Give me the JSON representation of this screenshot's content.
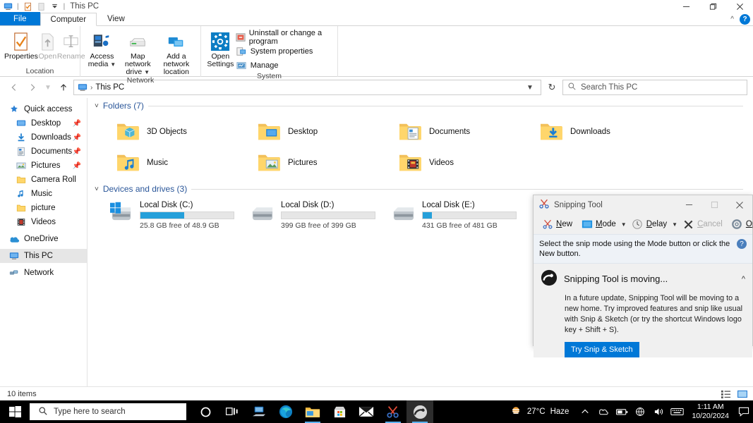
{
  "window": {
    "title": "This PC",
    "quick_access_icons": [
      "this-pc-icon",
      "properties-icon",
      "new-folder-icon",
      "customize-icon"
    ],
    "controls": {
      "minimize": "minimize-icon",
      "restore": "restore-icon",
      "close": "close-icon"
    },
    "ribbon_collapse": "chevron-up-icon",
    "help": "?"
  },
  "tabs": [
    {
      "label": "File",
      "state": "file-menu"
    },
    {
      "label": "Computer",
      "state": "active"
    },
    {
      "label": "View",
      "state": "normal"
    }
  ],
  "ribbon": {
    "groups": [
      {
        "label": "Location",
        "big_buttons": [
          {
            "label": "Properties",
            "icon": "properties-icon",
            "enabled": true
          },
          {
            "label": "Open",
            "icon": "open-icon",
            "enabled": false
          },
          {
            "label": "Rename",
            "icon": "rename-icon",
            "enabled": false
          }
        ]
      },
      {
        "label": "Network",
        "big_buttons": [
          {
            "label": "Access media",
            "icon": "access-media-icon",
            "enabled": true,
            "dropdown": true
          },
          {
            "label": "Map network drive",
            "icon": "map-network-drive-icon",
            "enabled": true,
            "dropdown": true
          },
          {
            "label": "Add a network location",
            "icon": "add-network-location-icon",
            "enabled": true,
            "dropdown": false
          }
        ]
      },
      {
        "label": "System",
        "big_buttons": [
          {
            "label": "Open Settings",
            "icon": "settings-gear-icon",
            "enabled": true
          }
        ],
        "small_buttons": [
          {
            "label": "Uninstall or change a program",
            "icon": "uninstall-icon"
          },
          {
            "label": "System properties",
            "icon": "system-properties-icon"
          },
          {
            "label": "Manage",
            "icon": "manage-icon"
          }
        ]
      }
    ]
  },
  "addressbar": {
    "back": "back-arrow-icon",
    "forward": "forward-arrow-icon",
    "recent": "chevron-down-icon",
    "up": "up-arrow-icon",
    "crumb_icon": "this-pc-icon",
    "crumb": "This PC",
    "separator": "›",
    "dropdown": "chevron-down-icon",
    "refresh": "↻"
  },
  "search": {
    "placeholder": "Search This PC",
    "icon": "search-icon"
  },
  "sidebar": {
    "items": [
      {
        "label": "Quick access",
        "icon": "star-pin-icon",
        "indent": false,
        "pinned": false,
        "selected": false
      },
      {
        "label": "Desktop",
        "icon": "desktop-icon",
        "indent": true,
        "pinned": true,
        "selected": false
      },
      {
        "label": "Downloads",
        "icon": "downloads-icon",
        "indent": true,
        "pinned": true,
        "selected": false
      },
      {
        "label": "Documents",
        "icon": "documents-icon",
        "indent": true,
        "pinned": true,
        "selected": false
      },
      {
        "label": "Pictures",
        "icon": "pictures-icon",
        "indent": true,
        "pinned": true,
        "selected": false
      },
      {
        "label": "Camera Roll",
        "icon": "folder-icon",
        "indent": true,
        "pinned": false,
        "selected": false
      },
      {
        "label": "Music",
        "icon": "music-icon",
        "indent": true,
        "pinned": false,
        "selected": false
      },
      {
        "label": "picture",
        "icon": "folder-icon",
        "indent": true,
        "pinned": false,
        "selected": false
      },
      {
        "label": "Videos",
        "icon": "videos-icon",
        "indent": true,
        "pinned": false,
        "selected": false
      },
      {
        "label": "OneDrive",
        "icon": "onedrive-icon",
        "indent": false,
        "pinned": false,
        "selected": false
      },
      {
        "label": "This PC",
        "icon": "this-pc-icon",
        "indent": false,
        "pinned": false,
        "selected": true
      },
      {
        "label": "Network",
        "icon": "network-icon",
        "indent": false,
        "pinned": false,
        "selected": false
      }
    ]
  },
  "content": {
    "folders_header": "Folders (7)",
    "folders": [
      {
        "name": "3D Objects",
        "icon": "folder-3d-objects-icon"
      },
      {
        "name": "Desktop",
        "icon": "folder-desktop-icon"
      },
      {
        "name": "Documents",
        "icon": "folder-documents-icon"
      },
      {
        "name": "Downloads",
        "icon": "folder-downloads-icon"
      },
      {
        "name": "Music",
        "icon": "folder-music-icon"
      },
      {
        "name": "Pictures",
        "icon": "folder-pictures-icon"
      },
      {
        "name": "Videos",
        "icon": "folder-videos-icon"
      }
    ],
    "drives_header": "Devices and drives (3)",
    "drives": [
      {
        "name": "Local Disk (C:)",
        "sub": "25.8 GB free of 48.9 GB",
        "used_percent": 47,
        "icon": "windows-drive-icon"
      },
      {
        "name": "Local Disk (D:)",
        "sub": "399 GB free of 399 GB",
        "used_percent": 0,
        "icon": "drive-icon"
      },
      {
        "name": "Local Disk (E:)",
        "sub": "431 GB free of 481 GB",
        "used_percent": 10,
        "icon": "drive-icon"
      }
    ]
  },
  "statusbar": {
    "text": "10 items",
    "view_details": "details-view-icon",
    "view_large_icons": "large-icons-view-icon"
  },
  "snipping_tool": {
    "title": "Snipping Tool",
    "icon": "snipping-tool-icon",
    "controls": {
      "minimize": "minimize-icon",
      "restore": "restore-icon",
      "close": "close-icon"
    },
    "toolbar": [
      {
        "label": "New",
        "icon": "new-snip-icon",
        "enabled": true,
        "dropdown": false
      },
      {
        "label": "Mode",
        "icon": "mode-icon",
        "enabled": true,
        "dropdown": true
      },
      {
        "label": "Delay",
        "icon": "delay-clock-icon",
        "enabled": true,
        "dropdown": true
      },
      {
        "label": "Cancel",
        "icon": "cancel-x-icon",
        "enabled": false,
        "dropdown": false
      },
      {
        "label": "Options",
        "icon": "options-gear-icon",
        "enabled": true,
        "dropdown": false
      }
    ],
    "message": "Select the snip mode using the Mode button or click the New button.",
    "help_icon": "help-icon",
    "promo": {
      "title": "Snipping Tool is moving...",
      "collapse_icon": "chevron-up-icon",
      "icon": "snip-sketch-icon",
      "body": "In a future update, Snipping Tool will be moving to a new home. Try improved features and snip like usual with Snip & Sketch (or try the shortcut Windows logo key + Shift + S).",
      "button": "Try Snip & Sketch"
    }
  },
  "taskbar": {
    "start": "windows-logo-icon",
    "search_placeholder": "Type here to search",
    "search_icon": "search-icon",
    "apps": [
      {
        "name": "cortana-icon",
        "active": false,
        "running": false
      },
      {
        "name": "task-view-icon",
        "active": false,
        "running": false
      },
      {
        "name": "remote-desktop-icon",
        "active": false,
        "running": false
      },
      {
        "name": "edge-icon",
        "active": false,
        "running": false
      },
      {
        "name": "file-explorer-icon",
        "active": false,
        "running": true
      },
      {
        "name": "microsoft-store-icon",
        "active": false,
        "running": false
      },
      {
        "name": "mail-icon",
        "active": false,
        "running": false
      },
      {
        "name": "snipping-tool-icon",
        "active": false,
        "running": true
      },
      {
        "name": "photos-icon",
        "active": true,
        "running": true
      }
    ],
    "weather": {
      "temperature": "27°C",
      "condition": "Haze",
      "icon": "haze-icon"
    },
    "tray": [
      "show-hidden-icons-icon",
      "onedrive-tray-icon",
      "battery-icon",
      "network-globe-icon",
      "volume-icon",
      "keyboard-icon"
    ],
    "clock": {
      "time": "1:11 AM",
      "date": "10/20/2024"
    },
    "notifications": "notification-icon"
  }
}
